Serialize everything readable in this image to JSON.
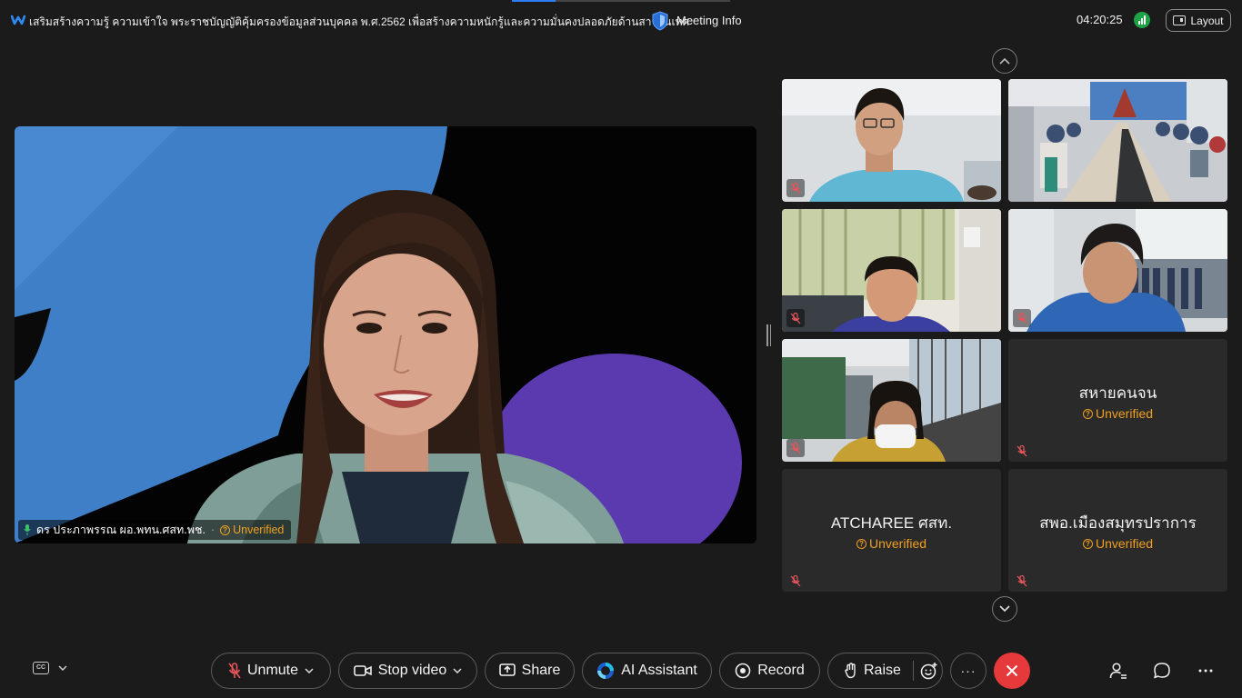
{
  "header": {
    "title": "เสริมสร้างความรู้ ความเข้าใจ พระราชบัญญัติคุ้มครองข้อมูลส่วนบุคคล พ.ศ.2562 เพื่อสร้างความหนักรู้และความมั่นคงปลอดภัยด้านสารสนเทศ",
    "meeting_info_label": "Meeting Info",
    "time": "04:20:25",
    "layout_label": "Layout"
  },
  "main_video": {
    "speaker_name": "ดร ประภาพรรณ ผอ.พทน.ศสท.พช.",
    "status": "Unverified"
  },
  "tiles": [
    {
      "type": "video",
      "scene": "man-office"
    },
    {
      "type": "video",
      "scene": "conference-room"
    },
    {
      "type": "video",
      "scene": "woman-curtains"
    },
    {
      "type": "video",
      "scene": "man-shelves"
    },
    {
      "type": "video",
      "scene": "woman-mask"
    },
    {
      "type": "name",
      "name": "สหายคนจน",
      "status": "Unverified"
    },
    {
      "type": "name",
      "name": "ATCHAREE ศสท.",
      "status": "Unverified"
    },
    {
      "type": "name",
      "name": "สพอ.เมืองสมุทรปราการ",
      "status": "Unverified"
    }
  ],
  "toolbar": {
    "unmute_label": "Unmute",
    "stop_video_label": "Stop video",
    "share_label": "Share",
    "ai_assistant_label": "AI Assistant",
    "record_label": "Record",
    "raise_label": "Raise",
    "more_label": "···"
  },
  "colors": {
    "background": "#1b1b1b",
    "tile": "#2a2a2a",
    "unverified": "#f0a020",
    "leave": "#e5393c",
    "signal": "#1ea446",
    "muted_mic": "#e8555a"
  }
}
